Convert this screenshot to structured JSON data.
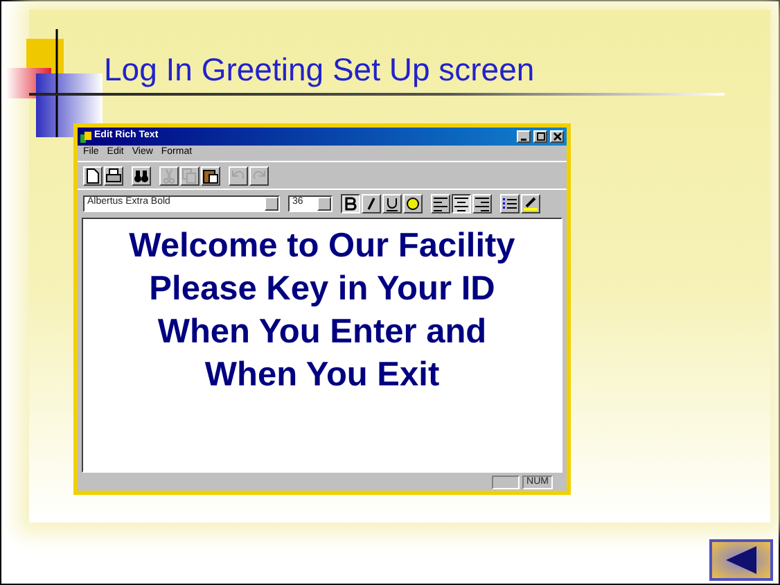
{
  "slide": {
    "title": "Log In Greeting Set Up screen"
  },
  "window": {
    "title": "Edit Rich Text",
    "menu": [
      "File",
      "Edit",
      "View",
      "Format"
    ],
    "toolbar": [
      {
        "kind": "new",
        "disabled": false
      },
      {
        "kind": "print",
        "disabled": false
      },
      {
        "kind": "find",
        "disabled": false
      },
      {
        "kind": "cut",
        "disabled": true
      },
      {
        "kind": "copy",
        "disabled": true
      },
      {
        "kind": "paste",
        "disabled": false
      },
      {
        "kind": "undo",
        "disabled": true
      },
      {
        "kind": "redo",
        "disabled": true
      }
    ],
    "font_name": "Albertus Extra Bold",
    "font_size": "36",
    "format_buttons": [
      {
        "kind": "bold",
        "pressed": true
      },
      {
        "kind": "italic",
        "pressed": false
      },
      {
        "kind": "underline",
        "pressed": false
      },
      {
        "kind": "color",
        "pressed": false
      },
      {
        "kind": "align-left",
        "pressed": false
      },
      {
        "kind": "align-center",
        "pressed": true
      },
      {
        "kind": "align-right",
        "pressed": false
      },
      {
        "kind": "bullets",
        "pressed": false
      },
      {
        "kind": "highlight",
        "pressed": false
      }
    ],
    "document_lines": [
      "Welcome to Our Facility",
      "Please Key in Your ID",
      "When You Enter and",
      "When You Exit"
    ],
    "status": "NUM"
  }
}
